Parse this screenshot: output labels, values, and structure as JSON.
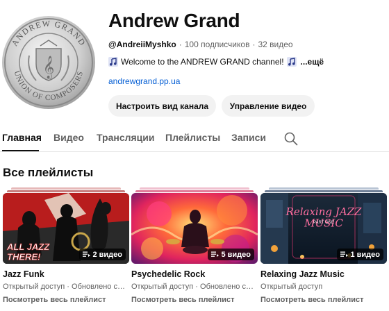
{
  "channel": {
    "title": "Andrew Grand",
    "handle": "@AndreiiMyshko",
    "separator": "·",
    "subscribers": "100 подписчиков",
    "videos": "32 видео",
    "description": "Welcome to the ANDREW GRAND channel!",
    "more": "...ещё",
    "link": "andrewgrand.pp.ua",
    "avatar_icon": "coin-seal-logo"
  },
  "buttons": {
    "customize": "Настроить вид канала",
    "manage": "Управление видео"
  },
  "tabs": [
    "Главная",
    "Видео",
    "Трансляции",
    "Плейлисты",
    "Записи"
  ],
  "active_tab": "Главная",
  "section_title": "Все плейлисты",
  "playlists": [
    {
      "title": "Jazz Funk",
      "count": "2 видео",
      "access": "Открытый доступ",
      "updated": "Обновлено сегодня",
      "view_all": "Посмотреть весь плейлист",
      "thumb_text": "ALL JAZZ THERE!"
    },
    {
      "title": "Psychedelic Rock",
      "count": "5 видео",
      "access": "Открытый доступ",
      "updated": "Обновлено сегодня",
      "view_all": "Посмотреть весь плейлист"
    },
    {
      "title": "Relaxing Jazz Music",
      "count": "1 видео",
      "access": "Открытый доступ",
      "updated": "",
      "view_all": "Посмотреть весь плейлист",
      "thumb_text": "Relaxing JAZZ MUSIC",
      "thumb_small": "PART ONE"
    }
  ],
  "colors": {
    "link": "#065fd4",
    "button_bg": "#f2f2f2",
    "muted": "#606060"
  }
}
